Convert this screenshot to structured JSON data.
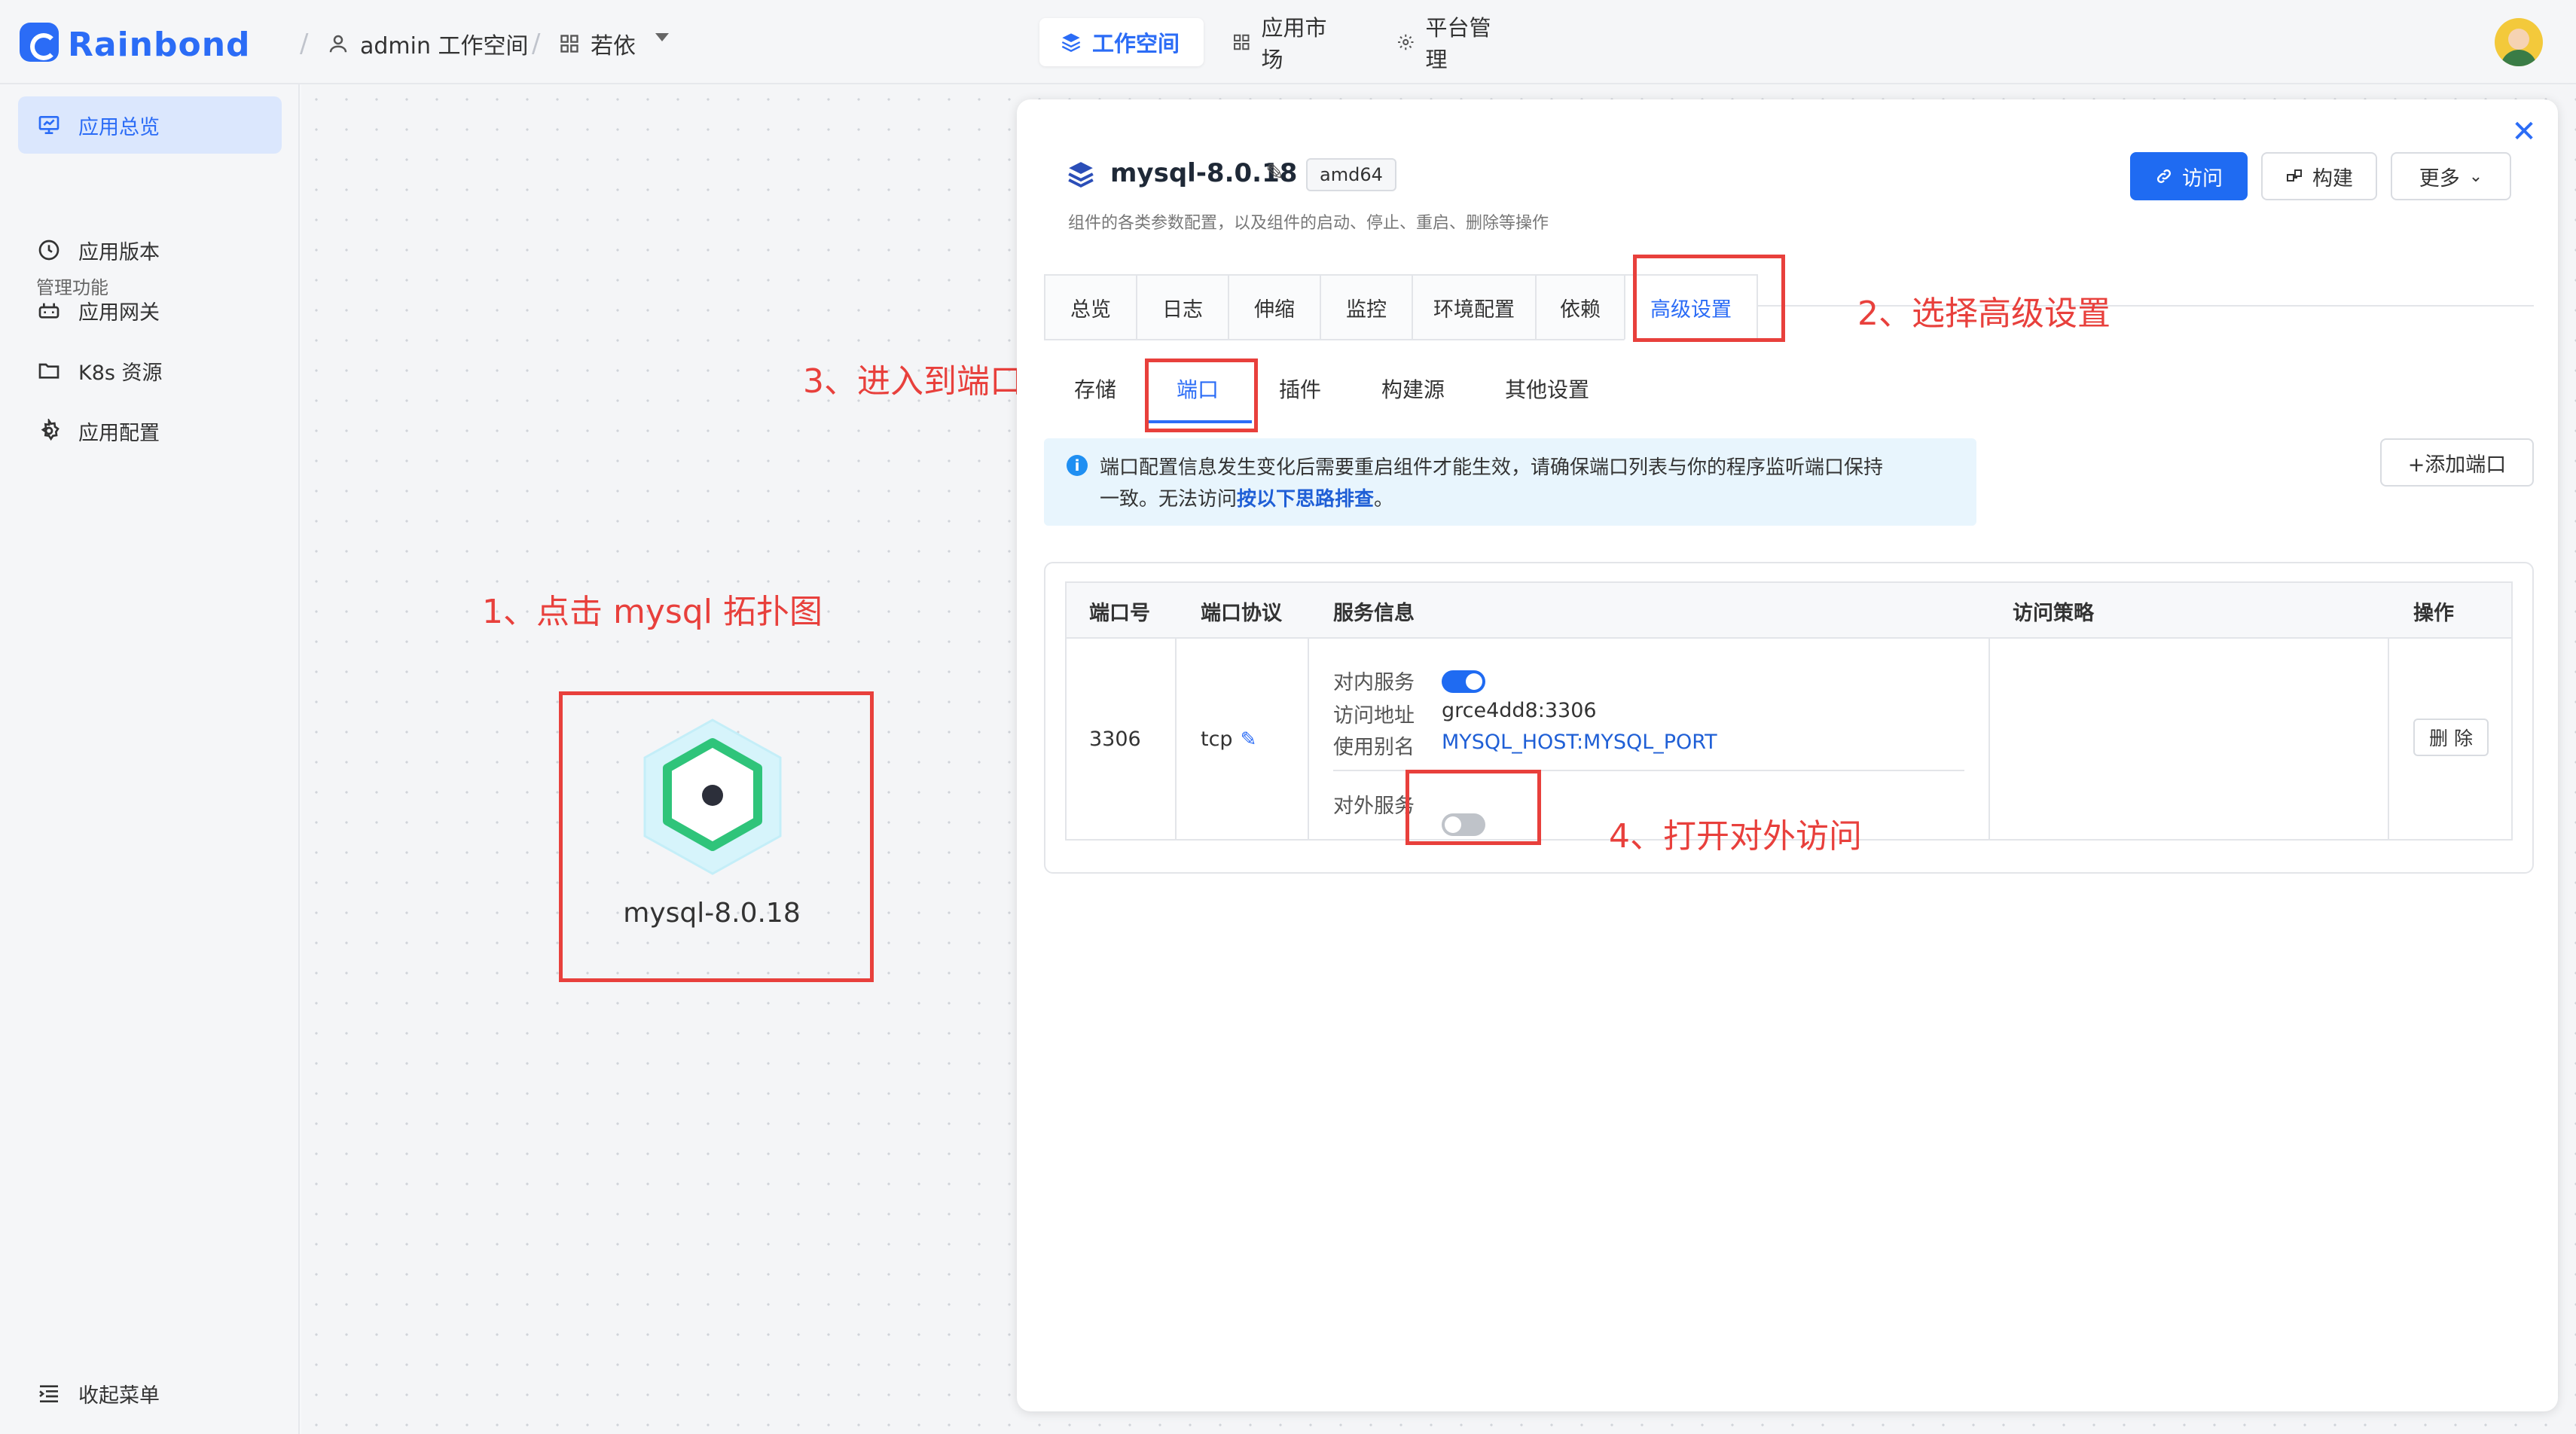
{
  "topbar": {
    "logo_text": "Rainbond",
    "workspace": "admin 工作空间",
    "team": "若依",
    "nav": [
      {
        "label": "工作空间",
        "icon": "layers-icon",
        "active": true
      },
      {
        "label": "应用市场",
        "icon": "grid-icon",
        "active": false
      },
      {
        "label": "平台管理",
        "icon": "gear-icon",
        "active": false
      }
    ]
  },
  "sidebar": {
    "overview": "应用总览",
    "section_label": "管理功能",
    "items": [
      {
        "label": "应用版本",
        "icon": "clock-icon"
      },
      {
        "label": "应用网关",
        "icon": "gateway-icon"
      },
      {
        "label": "K8s 资源",
        "icon": "folder-icon"
      },
      {
        "label": "应用配置",
        "icon": "gear-icon"
      }
    ],
    "collapse": "收起菜单"
  },
  "canvas": {
    "node_label": "mysql-8.0.18",
    "annotations": {
      "step1": "1、点击 mysql 拓扑图",
      "step2": "2、选择高级设置",
      "step3": "3、进入到端口",
      "step4": "4、打开对外访问"
    }
  },
  "drawer": {
    "title": "mysql-8.0.18",
    "arch_badge": "amd64",
    "subtitle": "组件的各类参数配置，以及组件的启动、停止、重启、删除等操作",
    "buttons": {
      "visit": "访问",
      "build": "构建",
      "more": "更多"
    },
    "tabs": [
      "总览",
      "日志",
      "伸缩",
      "监控",
      "环境配置",
      "依赖",
      "高级设置"
    ],
    "subtabs": [
      "存储",
      "端口",
      "插件",
      "构建源",
      "其他设置"
    ],
    "notice_text": "端口配置信息发生变化后需要重启组件才能生效，请确保端口列表与你的程序监听端口保持",
    "notice_text2": "一致。无法访问",
    "notice_link": "按以下思路排查",
    "notice_end": "。",
    "add_port": "+添加端口",
    "table": {
      "headers": [
        "端口号",
        "端口协议",
        "服务信息",
        "访问策略",
        "操作"
      ],
      "row": {
        "port": "3306",
        "protocol": "tcp",
        "inner_service_label": "对内服务",
        "inner_service_on": true,
        "address_label": "访问地址",
        "address": "grce4dd8:3306",
        "alias_label": "使用别名",
        "alias": "MYSQL_HOST:MYSQL_PORT",
        "outer_service_label": "对外服务",
        "outer_service_on": false,
        "delete": "删 除"
      }
    }
  }
}
